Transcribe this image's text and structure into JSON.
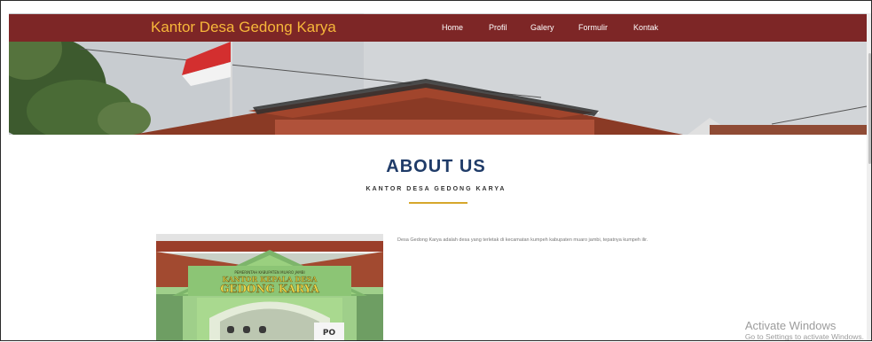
{
  "navbar": {
    "brand": "Kantor Desa Gedong Karya",
    "items": [
      {
        "label": "Home"
      },
      {
        "label": "Profil"
      },
      {
        "label": "Galery"
      },
      {
        "label": "Formulir"
      },
      {
        "label": "Kontak"
      }
    ]
  },
  "about": {
    "title": "ABOUT US",
    "subtitle": "KANTOR DESA GEDONG KARYA",
    "description": "Desa Gedong Karya adalah desa yang terletak di kecamatan kumpeh kabupaten muaro jambi, tepatnya kumpeh ilir."
  },
  "office_sign": {
    "line1": "PEMERINTAH KABUPATEN MUARO JAMBI",
    "line2": "KANTOR KEPALA DESA",
    "line3": "GEDONG KARYA"
  },
  "watermark": {
    "title": "Activate Windows",
    "subtitle": "Go to Settings to activate Windows."
  },
  "colors": {
    "navbar": "#7d2626",
    "brand": "#f7b73a",
    "title": "#1f3b68",
    "divider": "#d6a72c"
  }
}
